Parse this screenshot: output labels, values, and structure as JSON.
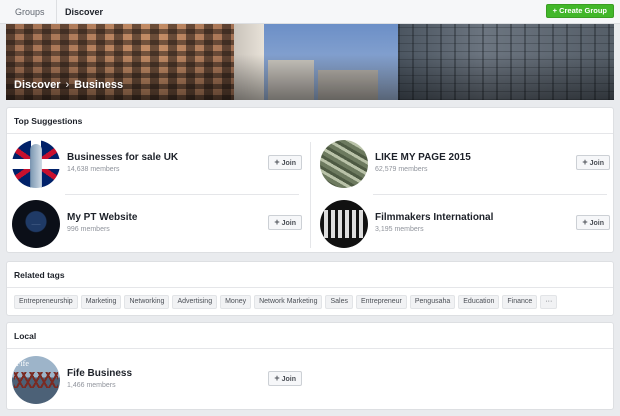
{
  "nav": {
    "tabs": [
      "Groups",
      "Discover"
    ],
    "create_label": "Create Group",
    "create_icon": "plus-icon"
  },
  "banner": {
    "breadcrumb": [
      "Discover",
      "Business"
    ]
  },
  "top_suggestions": {
    "title": "Top Suggestions",
    "join_label": "Join",
    "groups": [
      {
        "name": "Businesses for sale UK",
        "members": "14,638 members"
      },
      {
        "name": "LIKE MY PAGE 2015",
        "members": "62,579 members"
      },
      {
        "name": "My PT Website",
        "members": "996 members"
      },
      {
        "name": "Filmmakers International",
        "members": "3,195 members"
      }
    ]
  },
  "related_tags": {
    "title": "Related tags",
    "tags": [
      "Entrepreneurship",
      "Marketing",
      "Networking",
      "Advertising",
      "Money",
      "Network Marketing",
      "Sales",
      "Entrepreneur",
      "Pengusaha",
      "Education",
      "Finance",
      "···"
    ]
  },
  "local": {
    "title": "Local",
    "groups": [
      {
        "name": "Fife Business",
        "members": "1,466 members"
      }
    ]
  }
}
